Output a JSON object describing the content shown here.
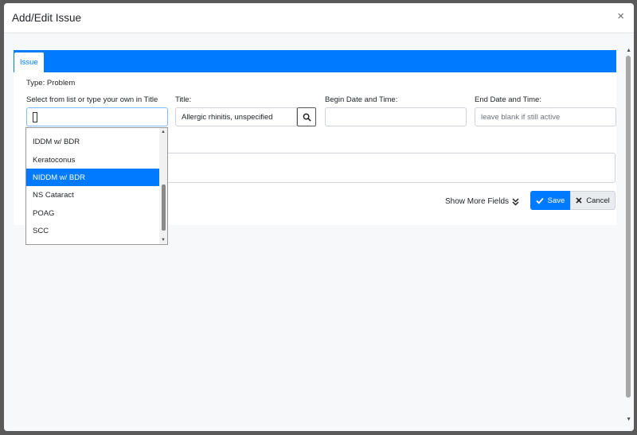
{
  "modal": {
    "title": "Add/Edit Issue",
    "close_symbol": "×"
  },
  "tabs": [
    {
      "label": "Issue",
      "active": true
    }
  ],
  "form": {
    "type_text": "Type: Problem",
    "select_label": "Select from list or type your own in Title",
    "title_label": "Title:",
    "title_value": "Allergic rhinitis, unspecified",
    "begin_label": "Begin Date and Time:",
    "begin_value": "",
    "end_label": "End Date and Time:",
    "end_placeholder": "leave blank if still active"
  },
  "dropdown": {
    "items": [
      {
        "label": "IDDM w/ BDR",
        "selected": false
      },
      {
        "label": "Keratoconus",
        "selected": false
      },
      {
        "label": "NIDDM w/ BDR",
        "selected": true
      },
      {
        "label": "NS Cataract",
        "selected": false
      },
      {
        "label": "POAG",
        "selected": false
      },
      {
        "label": "SCC",
        "selected": false
      }
    ]
  },
  "actions": {
    "more_fields": "Show More Fields",
    "save": "Save",
    "cancel": "Cancel"
  },
  "colors": {
    "primary": "#007bff",
    "selected_bg": "#007bff"
  }
}
